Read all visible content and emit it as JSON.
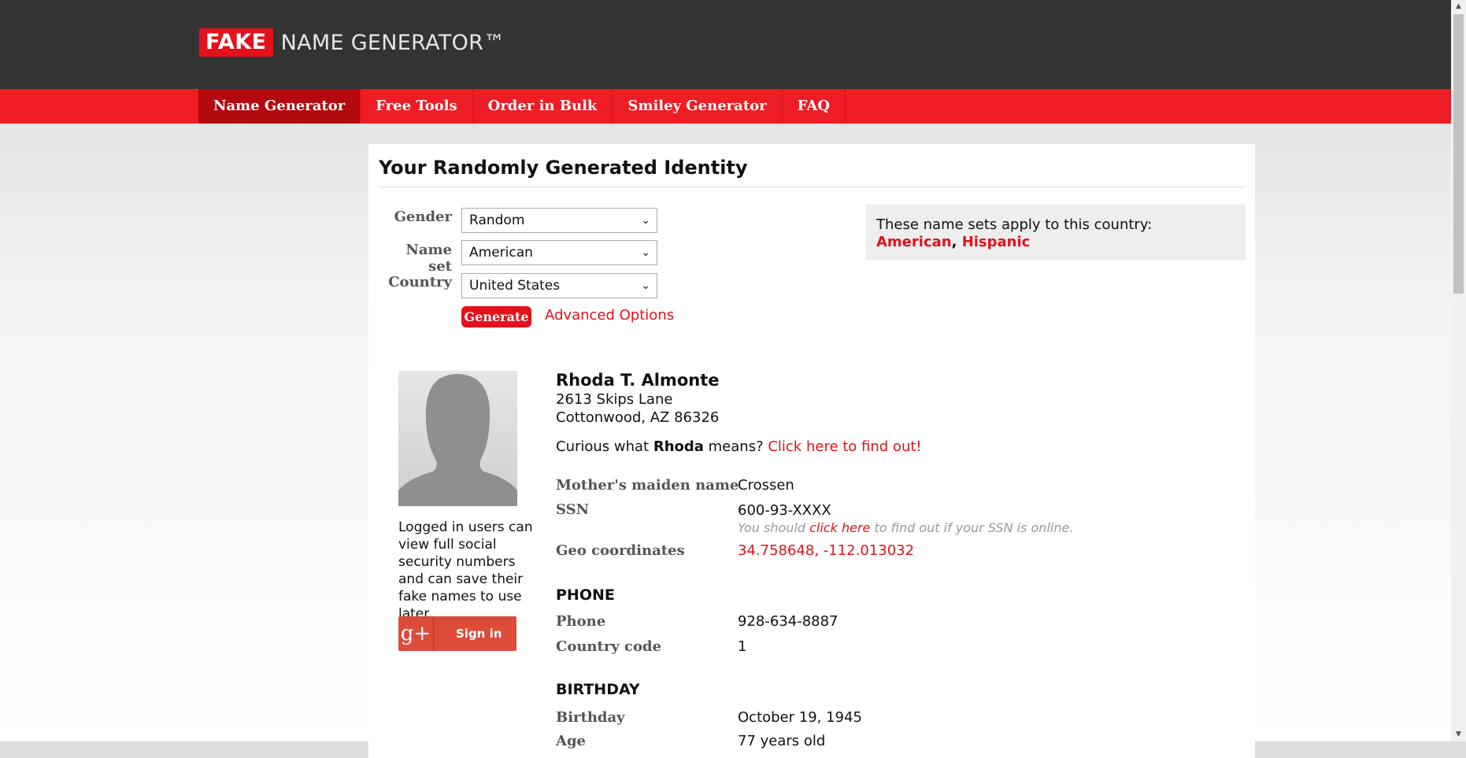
{
  "header": {
    "logo_fake": "FAKE",
    "logo_rest": "NAME GENERATOR™"
  },
  "nav": {
    "items": [
      "Name Generator",
      "Free Tools",
      "Order in Bulk",
      "Smiley Generator",
      "FAQ"
    ],
    "active": "Name Generator"
  },
  "form": {
    "title": "Your Randomly Generated Identity",
    "gender_label": "Gender",
    "gender_value": "Random",
    "nameset_label": "Name set",
    "nameset_value": "American",
    "country_label": "Country",
    "country_value": "United States",
    "generate_label": "Generate",
    "advanced_label": "Advanced Options"
  },
  "namesets_box": {
    "text": "These name sets apply to this country:",
    "links": [
      "American",
      "Hispanic"
    ],
    "separator": ", "
  },
  "sidebar": {
    "login_text": "Logged in users can view full social security numbers and can save their fake names to use later.",
    "gplus_icon": "g+",
    "signin_label": "Sign in"
  },
  "identity": {
    "name": "Rhoda T. Almonte",
    "address_line1": "2613 Skips Lane",
    "address_line2": "Cottonwood, AZ 86326",
    "curious_prefix": "Curious what ",
    "curious_name": "Rhoda",
    "curious_suffix": " means? ",
    "curious_link": "Click here to find out!",
    "maiden_label": "Mother's maiden name",
    "maiden_value": "Crossen",
    "ssn_label": "SSN",
    "ssn_value": "600-93-XXXX",
    "ssn_note_prefix": "You should ",
    "ssn_note_link": "click here",
    "ssn_note_suffix": " to find out if your SSN is online.",
    "geo_label": "Geo coordinates",
    "geo_value": "34.758648, -112.013032",
    "phone_section": "PHONE",
    "phone_label": "Phone",
    "phone_value": "928-634-8887",
    "cc_label": "Country code",
    "cc_value": "1",
    "birthday_section": "BIRTHDAY",
    "birthday_label": "Birthday",
    "birthday_value": "October 19, 1945",
    "age_label": "Age",
    "age_value": "77 years old"
  },
  "icons": {
    "select_chevron": "chevron-down-icon",
    "scroll_up": "scroll-up-icon",
    "scroll_down": "scroll-down-icon"
  },
  "colors": {
    "brand_red": "#e3111b",
    "nav_red": "#ee1c24",
    "nav_active": "#b4090f",
    "header_dark": "#333333",
    "gplus_red": "#dd4b39"
  }
}
